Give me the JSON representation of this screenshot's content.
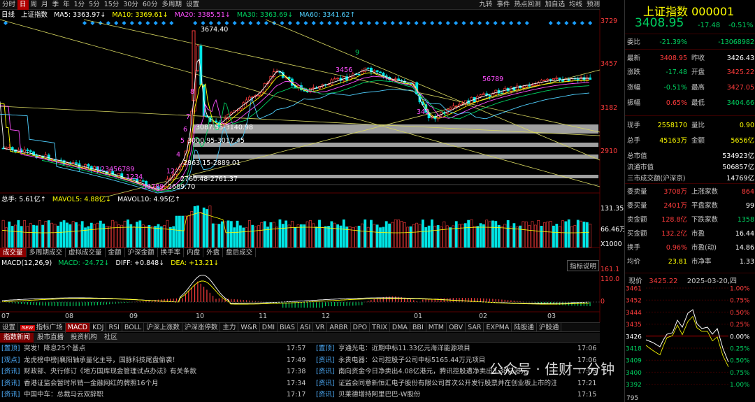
{
  "toolbar": {
    "items": [
      "分时",
      "日",
      "周",
      "月",
      "季",
      "年",
      "1分",
      "5分",
      "15分",
      "30分",
      "60分",
      "多周期",
      "设置"
    ],
    "active": "日",
    "right": [
      "九转",
      "事件",
      "热点回测",
      "加自选",
      "均线",
      "预测"
    ]
  },
  "ma_legend": {
    "name": "日线",
    "index": "上证指数",
    "ma5": "MA5: 3363.97↓",
    "ma10": "MA10: 3369.61↓",
    "ma20": "MA20: 3385.51↓",
    "ma30": "MA30: 3363.69↓",
    "ma60": "MA60: 3341.62↑"
  },
  "price_axis": [
    "3729",
    "3457",
    "3182",
    "2910"
  ],
  "annotations": {
    "high": "3674.40",
    "low": "2689.70",
    "z1": "3087.53-3140.98",
    "z2": "3000.95-3017.45",
    "z3": "2863.15-2889.01",
    "z4": "2760.48-2761.37",
    "seq_a": "123456789",
    "seq_b": "1234",
    "seq_c": "56789",
    "seq_d": "12",
    "seq_e": "3456",
    "seq_f": "345",
    "seq_g": "56789",
    "n9": "9",
    "n8": "8",
    "n7": "7",
    "n6": "6",
    "n5": "5",
    "n4": "4"
  },
  "vol_legend": {
    "total": "总手: 5.61亿↑",
    "mavol5": "MAVOL5: 4.88亿↓",
    "mavol10": "MAVOL10: 4.95亿↑"
  },
  "vol_axis": [
    "131.35万",
    "66.46万",
    "X1000"
  ],
  "vol_tabs": [
    "成交量",
    "多周期成交",
    "虚拟成交量",
    "金额",
    "沪深金额",
    "换手率",
    "内盘",
    "外盘",
    "盘后成交"
  ],
  "macd_legend": {
    "name": "MACD(12,26,9)",
    "macd": "MACD: -24.72↓",
    "diff": "DIFF: +0.848↓",
    "dea": "DEA: +13.21↓",
    "explain": "指标说明"
  },
  "macd_axis": [
    "161.1",
    "110.0",
    "0"
  ],
  "months": [
    "07",
    "08",
    "09",
    "10",
    "11",
    "12",
    "01",
    "02",
    "03"
  ],
  "indicator_tabs": [
    "设置",
    "指标广场",
    "MACD",
    "KDJ",
    "RSI",
    "BOLL",
    "沪深上涨数",
    "沪深涨停数",
    "主力",
    "W&R",
    "DMI",
    "BIAS",
    "ASI",
    "VR",
    "ARBR",
    "DPO",
    "TRIX",
    "DMA",
    "BBI",
    "MTM",
    "OBV",
    "SAR",
    "EXPMA",
    "陆股通",
    "沪股通"
  ],
  "new_badge": "NEW",
  "news_tabs": [
    "指数新闻",
    "股市直播",
    "投资机构",
    "社区"
  ],
  "news_left": [
    {
      "tag": "置顶",
      "title": "突发！降息25个基点",
      "time": "17:57"
    },
    {
      "tag": "观点",
      "title": "龙虎榜中榜|襄阳轴承量化主导，国脉科技尾盘偷袭！",
      "time": "17:49"
    },
    {
      "tag": "资讯",
      "title": "财政部、央行修订《地方国库现金管理试点办法》有关条款",
      "time": "17:38"
    },
    {
      "tag": "资讯",
      "title": "香港证监会暂时吊销一金融网红的牌照16个月",
      "time": "17:34"
    },
    {
      "tag": "资讯",
      "title": "中国中车：总裁马云双辞职",
      "time": "17:17"
    }
  ],
  "news_right": [
    {
      "tag": "置顶",
      "title": "亨通光电：近期中标11.33亿元海洋能源项目",
      "time": "17:06"
    },
    {
      "tag": "资讯",
      "title": "永贵电器：公司控股子公司中标5165.44万元项目",
      "time": "17:06"
    },
    {
      "tag": "资讯",
      "title": "南向资金今日净卖出4.08亿港元，腾讯控股遭净卖出3.38亿港元",
      "time": "17:05"
    },
    {
      "tag": "资讯",
      "title": "证监会同意新恒汇电子股份有限公司首次公开发行股票并在创业板上市的注册申请",
      "time": "17:21"
    },
    {
      "tag": "资讯",
      "title": "贝莱德增持阿里巴巴-W股份",
      "time": "17:15"
    }
  ],
  "watermark": "公众号 · 佳财一分钟",
  "quote": {
    "name": "上证指数",
    "code": "000001",
    "price": "3408.95",
    "chg": "-17.48",
    "pct": "-0.51%"
  },
  "quote_rows": [
    {
      "k": "委比",
      "v": "-21.39%",
      "k2": "",
      "v2": "-13068982"
    },
    {
      "k": "最新",
      "v": "3408.95",
      "k2": "昨收",
      "v2": "3426.43"
    },
    {
      "k": "涨跌",
      "v": "-17.48",
      "k2": "开盘",
      "v2": "3425.22"
    },
    {
      "k": "涨幅",
      "v": "-0.51%",
      "k2": "最高",
      "v2": "3427.05"
    },
    {
      "k": "振幅",
      "v": "0.65%",
      "k2": "最低",
      "v2": "3404.66"
    },
    {
      "k": "现手",
      "v": "2558170",
      "k2": "量比",
      "v2": "0.90"
    },
    {
      "k": "总手",
      "v": "45163万",
      "k2": "金额",
      "v2": "5656亿"
    },
    {
      "k": "总市值",
      "v": "",
      "k2": "",
      "v2": "534923亿"
    },
    {
      "k": "流通市值",
      "v": "",
      "k2": "",
      "v2": "506857亿"
    },
    {
      "k": "三市成交额(沪深京)",
      "v": "",
      "k2": "",
      "v2": "14769亿"
    },
    {
      "k": "委卖量",
      "v": "3708万",
      "k2": "上涨家数",
      "v2": "864"
    },
    {
      "k": "委买量",
      "v": "2401万",
      "k2": "平盘家数",
      "v2": "99"
    },
    {
      "k": "卖金额",
      "v": "128.8亿",
      "k2": "下跌家数",
      "v2": "1358"
    },
    {
      "k": "买金额",
      "v": "132.2亿",
      "k2": "市盈",
      "v2": "16.44"
    },
    {
      "k": "换手",
      "v": "0.96%",
      "k2": "市盈(动)",
      "v2": "14.86"
    },
    {
      "k": "均价",
      "v": "23.81",
      "k2": "市净率",
      "v2": "1.33"
    }
  ],
  "mini": {
    "label": "现价",
    "price": "3425.22",
    "date": "2025-03-20,四",
    "left_axis": [
      "3461",
      "3452",
      "3444",
      "3435",
      "3426",
      "3418",
      "3409",
      "3400",
      "3392"
    ],
    "right_axis": [
      "1.00%",
      "0.75%",
      "0.50%",
      "0.25%",
      "0.00%",
      "0.25%",
      "0.50%",
      "0.75%",
      "1.00%"
    ],
    "vol": "795"
  },
  "colors": {
    "up": "#ff3c3c",
    "down": "#00e5e5",
    "ma5": "#ffffff",
    "ma10": "#ffff00",
    "ma20": "#ff4fff",
    "ma30": "#00d060",
    "ma60": "#4fd0ff"
  }
}
